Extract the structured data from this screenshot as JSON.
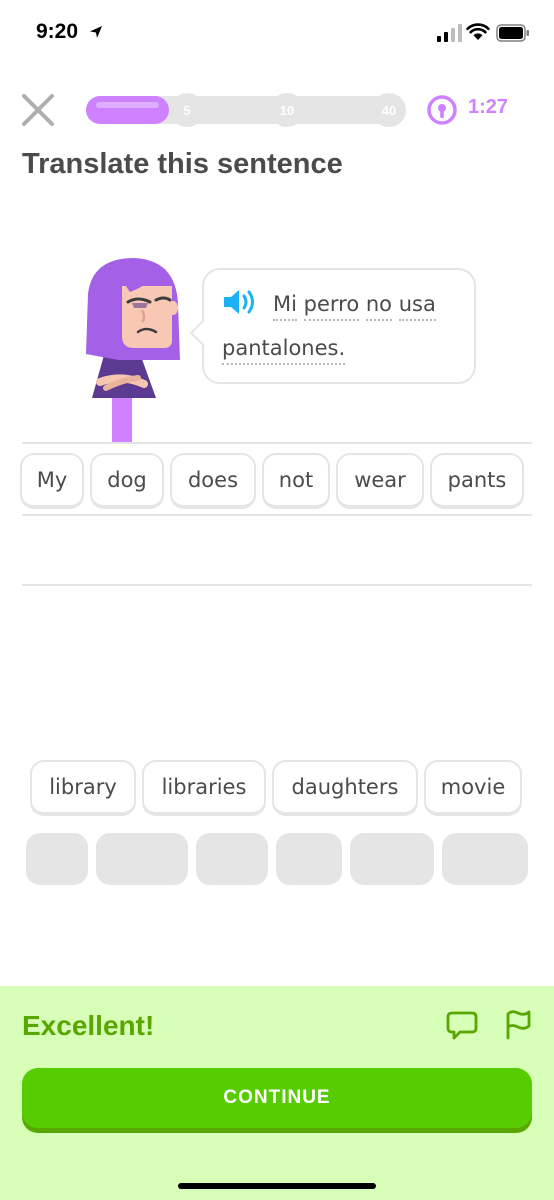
{
  "status_bar": {
    "time": "9:20"
  },
  "header": {
    "progress_fraction": 0.26,
    "milestones": [
      "5",
      "10",
      "40"
    ],
    "timer": "1:27",
    "accent_color": "#ce82ff"
  },
  "title": "Translate this sentence",
  "prompt": {
    "words_line1": [
      "Mi",
      "perro",
      "no",
      "usa"
    ],
    "words_line2": [
      "pantalones."
    ]
  },
  "answer_chips": [
    "My",
    "dog",
    "does",
    "not",
    "wear",
    "pants"
  ],
  "bank_chips": [
    "library",
    "libraries",
    "daughters",
    "movie"
  ],
  "feedback": {
    "message": "Excellent!",
    "continue_label": "CONTINUE",
    "panel_color": "#d7ffb8",
    "button_color": "#58cc02"
  }
}
